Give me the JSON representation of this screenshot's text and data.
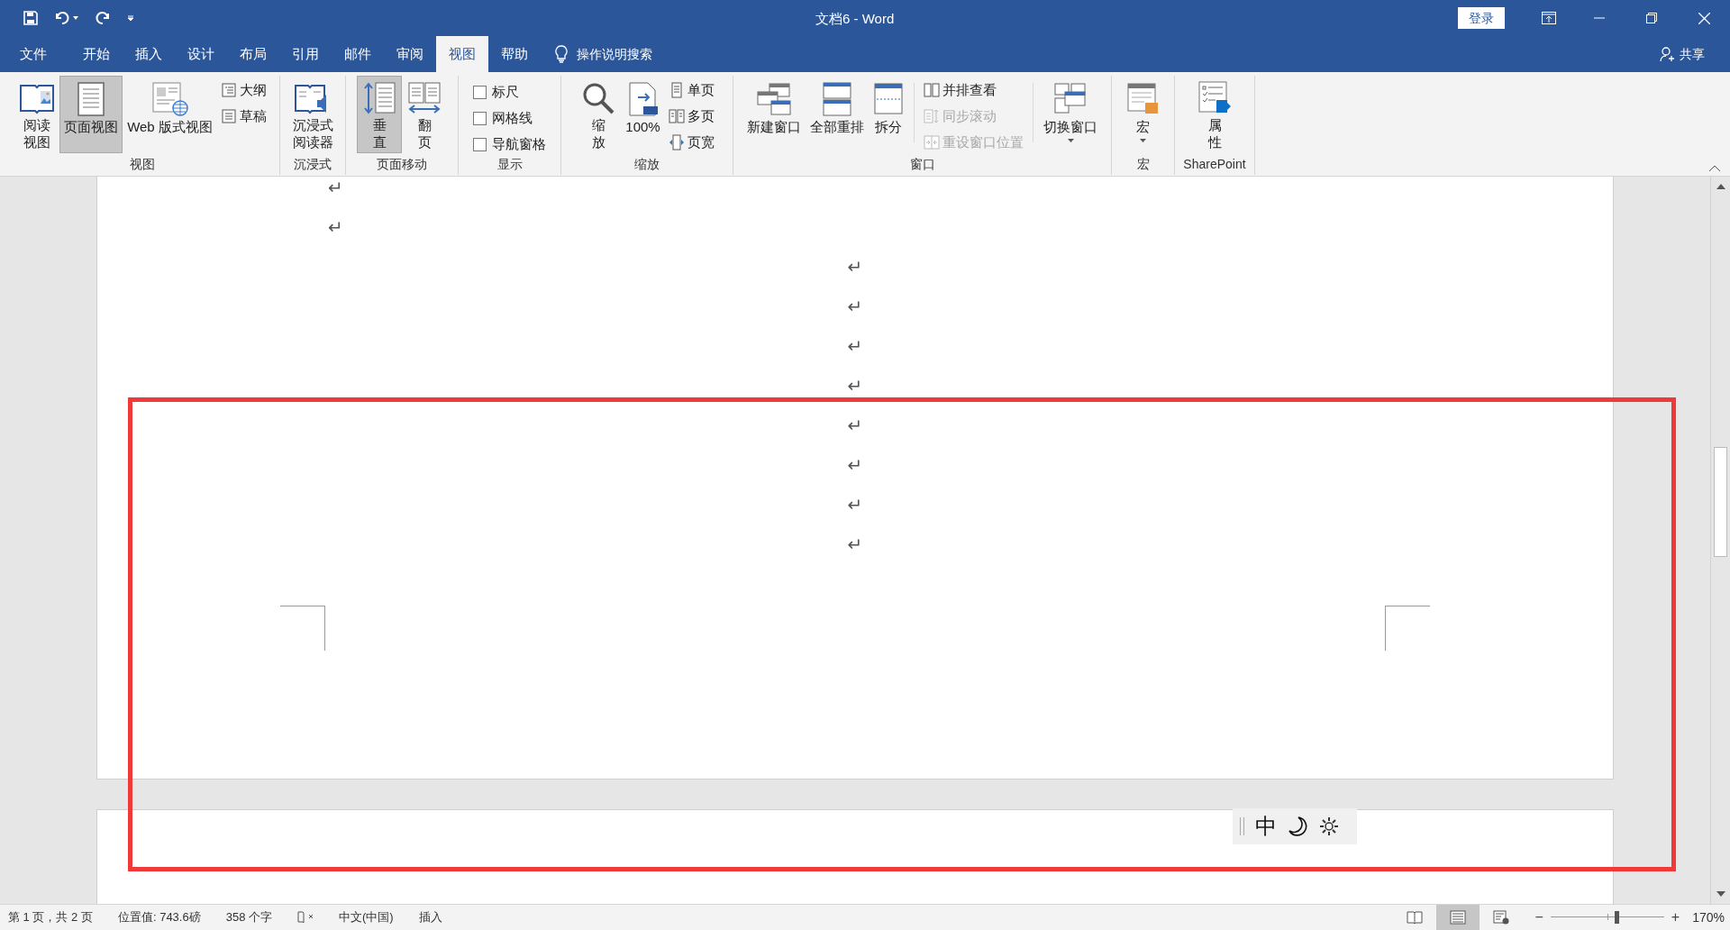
{
  "window": {
    "title": "文档6 - Word",
    "login_button": "登录"
  },
  "tabs": [
    {
      "label": "文件",
      "selected": false
    },
    {
      "label": "开始",
      "selected": false
    },
    {
      "label": "插入",
      "selected": false
    },
    {
      "label": "设计",
      "selected": false
    },
    {
      "label": "布局",
      "selected": false
    },
    {
      "label": "引用",
      "selected": false
    },
    {
      "label": "邮件",
      "selected": false
    },
    {
      "label": "审阅",
      "selected": false
    },
    {
      "label": "视图",
      "selected": true
    },
    {
      "label": "帮助",
      "selected": false
    }
  ],
  "tell_me": {
    "placeholder": "操作说明搜索"
  },
  "share": "共享",
  "ribbon": {
    "groups": [
      {
        "label": "视图",
        "items": [
          {
            "kind": "large",
            "lines": [
              "阅读",
              "视图"
            ],
            "selected": false
          },
          {
            "kind": "large",
            "lines": [
              "页面视图"
            ],
            "selected": true
          },
          {
            "kind": "large",
            "lines": [
              "Web 版式视图"
            ],
            "selected": false
          },
          {
            "kind": "stack",
            "entries": [
              {
                "label": "大纲",
                "disabled": false
              },
              {
                "label": "草稿",
                "disabled": false
              }
            ]
          }
        ]
      },
      {
        "label": "沉浸式",
        "items": [
          {
            "kind": "large",
            "lines": [
              "沉浸式",
              "阅读器"
            ],
            "selected": false
          }
        ]
      },
      {
        "label": "页面移动",
        "items": [
          {
            "kind": "large",
            "lines": [
              "垂",
              "直"
            ],
            "selected": true
          },
          {
            "kind": "large",
            "lines": [
              "翻",
              "页"
            ],
            "selected": false
          }
        ]
      },
      {
        "label": "显示",
        "items": [
          {
            "kind": "checks",
            "entries": [
              {
                "label": "标尺",
                "checked": false
              },
              {
                "label": "网格线",
                "checked": false
              },
              {
                "label": "导航窗格",
                "checked": false
              }
            ]
          }
        ]
      },
      {
        "label": "缩放",
        "items": [
          {
            "kind": "large",
            "lines": [
              "缩",
              "放"
            ],
            "selected": false
          },
          {
            "kind": "large",
            "lines": [
              "100%"
            ],
            "selected": false
          },
          {
            "kind": "stack",
            "entries": [
              {
                "label": "单页",
                "disabled": false
              },
              {
                "label": "多页",
                "disabled": false
              },
              {
                "label": "页宽",
                "disabled": false
              }
            ]
          }
        ]
      },
      {
        "label": "窗口",
        "items": [
          {
            "kind": "large",
            "lines": [
              "新建窗口"
            ],
            "selected": false
          },
          {
            "kind": "large",
            "lines": [
              "全部重排"
            ],
            "selected": false
          },
          {
            "kind": "large",
            "lines": [
              "拆分"
            ],
            "selected": false
          },
          {
            "kind": "separator"
          },
          {
            "kind": "stack",
            "entries": [
              {
                "label": "并排查看",
                "disabled": false
              },
              {
                "label": "同步滚动",
                "disabled": true
              },
              {
                "label": "重设窗口位置",
                "disabled": true
              }
            ]
          },
          {
            "kind": "separator"
          },
          {
            "kind": "large",
            "lines": [
              "切换窗口"
            ],
            "selected": false,
            "dropdown": true
          }
        ]
      },
      {
        "label": "宏",
        "items": [
          {
            "kind": "large",
            "lines": [
              "宏"
            ],
            "selected": false,
            "dropdown": true
          }
        ]
      },
      {
        "label": "SharePoint",
        "items": [
          {
            "kind": "large",
            "lines": [
              "属",
              "性"
            ],
            "selected": false
          }
        ]
      }
    ]
  },
  "document": {
    "paragraph_marks": [
      {
        "text": "↵",
        "kind": "indented"
      },
      {
        "text": "↵",
        "kind": "indented"
      },
      {
        "text": "↵",
        "kind": "centered"
      },
      {
        "text": "↵",
        "kind": "centered"
      },
      {
        "text": "↵",
        "kind": "centered"
      },
      {
        "text": "↵",
        "kind": "centered"
      },
      {
        "text": "↵",
        "kind": "centered"
      },
      {
        "text": "↵",
        "kind": "centered"
      },
      {
        "text": "↵",
        "kind": "centered"
      },
      {
        "text": "↵",
        "kind": "centered"
      }
    ]
  },
  "annotation": {
    "kind": "frame"
  },
  "ime_toolbar": {
    "mode": "中"
  },
  "status_bar": {
    "items": [
      {
        "kind": "text",
        "text": "第 1 页，共 2 页"
      },
      {
        "kind": "text",
        "text": "位置值: 743.6磅"
      },
      {
        "kind": "text",
        "text": "358 个字"
      },
      {
        "kind": "proofing"
      },
      {
        "kind": "text",
        "text": "中文(中国)"
      },
      {
        "kind": "text",
        "text": "插入"
      }
    ],
    "views": [
      {
        "selected": false
      },
      {
        "selected": true
      },
      {
        "selected": false
      }
    ],
    "zoom": {
      "minus": "−",
      "plus": "+",
      "level": 0.58,
      "reading": "170%"
    }
  }
}
